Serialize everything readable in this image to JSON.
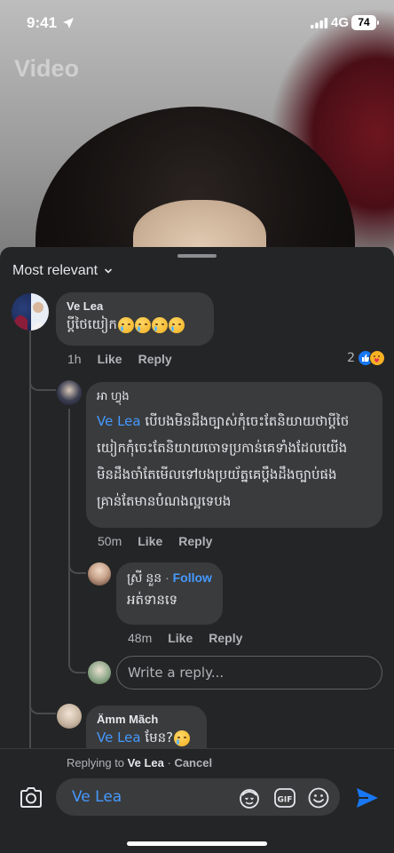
{
  "status_bar": {
    "time": "9:41",
    "network": "4G",
    "battery": "74"
  },
  "video": {
    "label": "Video"
  },
  "sort": {
    "label": "Most relevant"
  },
  "comments": [
    {
      "author": "Ve Lea",
      "text": "ប្ដីថៃយៀក",
      "emoji_count": 4,
      "time": "1h",
      "like_label": "Like",
      "reply_label": "Reply",
      "reaction_count": "2"
    },
    {
      "author": "អា ហ្វុង",
      "mention": "Ve Lea",
      "lines": [
        " បើបងមិនដឹងច្បាស់កុំចេះតែនិយាយថាប្តីថៃ",
        "យៀកកុំចេះតែនិយាយចោទប្រកាន់គេទាំងដែលយើង",
        "មិនដឹងចាំតែមើលទៅបងប្រយ័ត្នគេប្តឹងដឹងច្បាប់ផង",
        "គ្រាន់តែមានបំណងល្អទេបង"
      ],
      "time": "50m",
      "like_label": "Like",
      "reply_label": "Reply"
    },
    {
      "author": "ស្រី នួន",
      "follow_label": "Follow",
      "text": "អត់ទានទេ",
      "time": "48m",
      "like_label": "Like",
      "reply_label": "Reply"
    },
    {
      "author": "Ämm Mãch",
      "mention": "Ve Lea",
      "text": " មែន?"
    }
  ],
  "reply_input": {
    "placeholder": "Write a reply..."
  },
  "composer": {
    "replying_prefix": "Replying to ",
    "replying_to": "Ve Lea",
    "cancel_label": "Cancel",
    "input_value": "Ve Lea"
  },
  "icons": {
    "camera": "camera-icon",
    "avatar_sticker": "avatar-sticker-icon",
    "gif": "gif-icon",
    "emoji": "emoji-icon",
    "send": "send-icon",
    "like_reaction": "like-reaction-icon",
    "care_reaction": "care-reaction-icon"
  },
  "colors": {
    "accent": "#4599ff",
    "sheet_bg": "#242526",
    "bubble_bg": "#3a3b3c",
    "send_blue": "#1877f2"
  }
}
